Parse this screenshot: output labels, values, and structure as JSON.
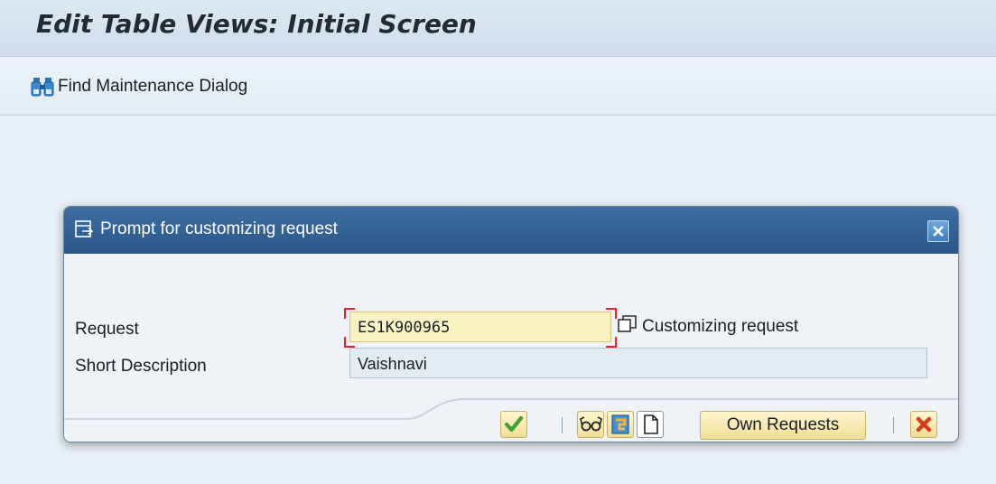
{
  "screen": {
    "title": "Edit Table Views: Initial Screen"
  },
  "toolbar": {
    "find_label": "Find Maintenance Dialog"
  },
  "dialog": {
    "title": "Prompt for customizing request",
    "request_label": "Request",
    "request_value": "ES1K900965",
    "request_type": "Customizing request",
    "desc_label": "Short Description",
    "desc_value": "Vaishnavi",
    "own_requests_label": "Own Requests"
  },
  "icons": {
    "find": "binoculars-icon",
    "dialog": "prompt-icon",
    "close": "close-icon",
    "value_help": "value-help-icon",
    "confirm": "checkmark-icon",
    "display": "glasses-icon",
    "create_task": "create-request-icon",
    "new": "new-document-icon",
    "cancel": "cancel-icon"
  },
  "colors": {
    "dialog_header": "#2a5789",
    "input_highlight": "#fbf2c4",
    "confirm_green": "#3fa02c",
    "cancel_red": "#d93a1a"
  }
}
